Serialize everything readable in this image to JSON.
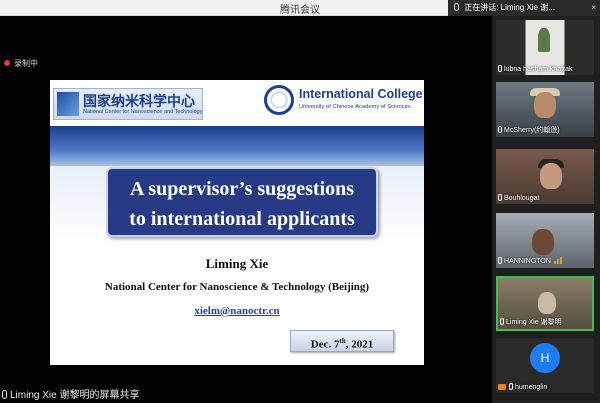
{
  "window": {
    "title": "腾讯会议"
  },
  "speaking": {
    "text": "正在讲话: Liming Xie 谢..."
  },
  "recording": {
    "label": "录制中"
  },
  "slide": {
    "ncnst_cn": "国家纳米科学中心",
    "ncnst_en": "National Center for Nanoscience and Technology",
    "college_name": "International College",
    "college_sub": "University of Chinese Academy of Sciences",
    "title_line1": "A supervisor’s suggestions",
    "title_line2": "to international applicants",
    "author": "Liming Xie",
    "institution": "National Center for Nanoscience & Technology (Beijing)",
    "email": "xielm@nanoctr.cn",
    "date_pre": "Dec. 7",
    "date_sup": "th",
    "date_post": ", 2021"
  },
  "share_label": "Liming Xie 谢黎明的屏幕共享",
  "participants": [
    {
      "name": "lubna hasham khattak"
    },
    {
      "name": "McSherry(约翰逊)"
    },
    {
      "name": "Bouhlougat"
    },
    {
      "name": "HANNINGTON"
    },
    {
      "name": "Liming Xie 谢黎明"
    },
    {
      "name": "humenglin",
      "initial": "H"
    }
  ],
  "colors": {
    "speaking_border": "#3fbf4f",
    "avatar_bg": "#1e7cf0",
    "rec_dot": "#e23b3b"
  }
}
